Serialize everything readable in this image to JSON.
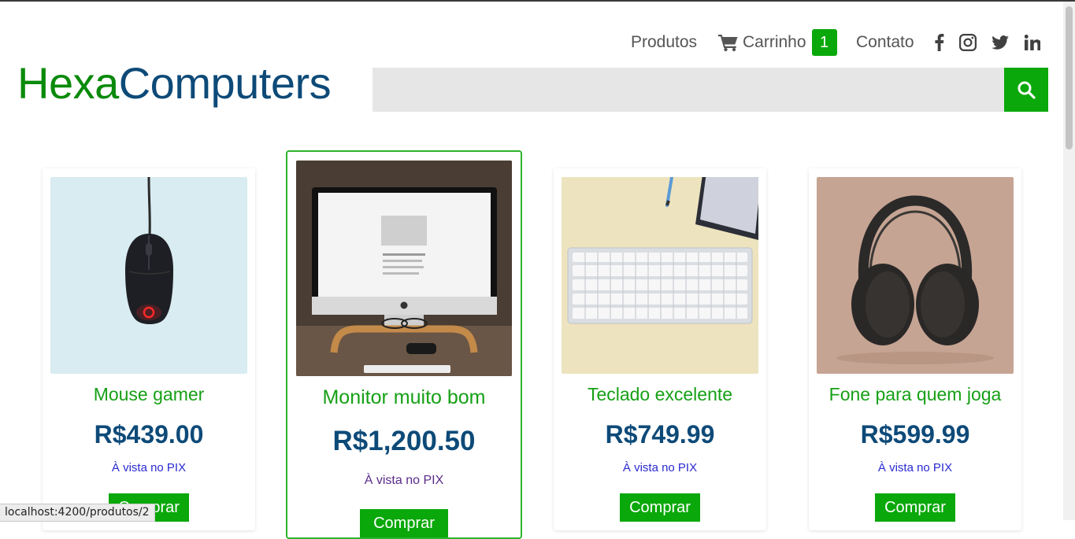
{
  "brand": {
    "part1": "Hexa",
    "part2": "Computers"
  },
  "nav": {
    "produtos": "Produtos",
    "carrinho": "Carrinho",
    "cart_count": "1",
    "contato": "Contato"
  },
  "social": [
    "facebook-icon",
    "instagram-icon",
    "twitter-icon",
    "linkedin-icon"
  ],
  "search": {
    "value": "",
    "placeholder": ""
  },
  "products": [
    {
      "name": "Mouse gamer",
      "price": "R$439.00",
      "payment": "À vista no PIX",
      "button": "Comprar"
    },
    {
      "name": "Monitor muito bom",
      "price": "R$1,200.50",
      "payment": "À vista no PIX",
      "button": "Comprar"
    },
    {
      "name": "Teclado excelente",
      "price": "R$749.99",
      "payment": "À vista no PIX",
      "button": "Comprar"
    },
    {
      "name": "Fone para quem joga",
      "price": "R$599.99",
      "payment": "À vista no PIX",
      "button": "Comprar"
    }
  ],
  "status_bar": "localhost:4200/produtos/2",
  "colors": {
    "brand_green": "#0a8a0a",
    "brand_blue": "#0d4a78",
    "accent_green": "#0aa80a"
  }
}
